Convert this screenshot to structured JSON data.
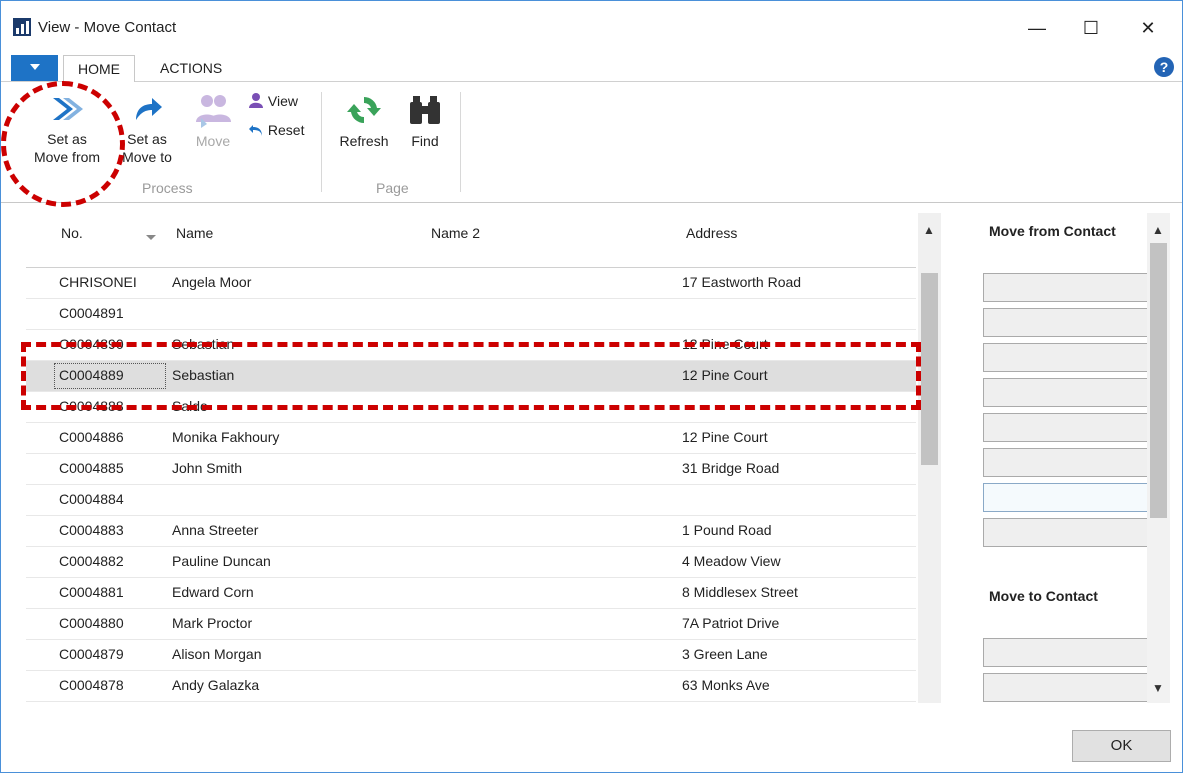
{
  "window": {
    "title": "View - Move Contact",
    "minimize": "—",
    "maximize": "☐",
    "close": "✕"
  },
  "tabs": [
    {
      "label": "HOME",
      "active": true
    },
    {
      "label": "ACTIONS",
      "active": false
    }
  ],
  "ribbon": {
    "set_move_from": "Set as Move from",
    "set_move_from_l1": "Set as",
    "set_move_from_l2": "Move from",
    "set_move_to_l1": "Set as",
    "set_move_to_l2": "Move to",
    "move": "Move",
    "view": "View",
    "reset": "Reset",
    "process_group": "Process",
    "refresh": "Refresh",
    "find": "Find",
    "page_group": "Page"
  },
  "grid": {
    "columns": [
      "No.",
      "Name",
      "Name 2",
      "Address"
    ],
    "rows": [
      {
        "no": "CHRISONEI",
        "name": "Angela Moor",
        "address": "17 Eastworth Road"
      },
      {
        "no": "C0004891",
        "name": "",
        "address": ""
      },
      {
        "no": "C0004890",
        "name": "Sebastian",
        "address": "12 Pine Court"
      },
      {
        "no": "C0004889",
        "name": "Sebastian",
        "address": "12 Pine Court",
        "selected": true
      },
      {
        "no": "C0004888",
        "name": "Saldo",
        "address": ""
      },
      {
        "no": "C0004886",
        "name": "Monika Fakhoury",
        "address": "12 Pine Court"
      },
      {
        "no": "C0004885",
        "name": "John Smith",
        "address": "31 Bridge Road"
      },
      {
        "no": "C0004884",
        "name": "",
        "address": ""
      },
      {
        "no": "C0004883",
        "name": "Anna Streeter",
        "address": "1 Pound Road"
      },
      {
        "no": "C0004882",
        "name": "Pauline Duncan",
        "address": "4 Meadow View"
      },
      {
        "no": "C0004881",
        "name": "Edward Corn",
        "address": "8 Middlesex Street"
      },
      {
        "no": "C0004880",
        "name": "Mark Proctor",
        "address": "7A Patriot Drive"
      },
      {
        "no": "C0004879",
        "name": "Alison Morgan",
        "address": "3 Green Lane"
      },
      {
        "no": "C0004878",
        "name": "Andy Galazka",
        "address": "63 Monks Ave"
      }
    ]
  },
  "right_panel": {
    "move_from_title": "Move from Contact",
    "move_to_title": "Move to Contact"
  },
  "footer": {
    "ok": "OK"
  },
  "colors": {
    "accent": "#1e73c6",
    "annotation": "#cc0000"
  }
}
